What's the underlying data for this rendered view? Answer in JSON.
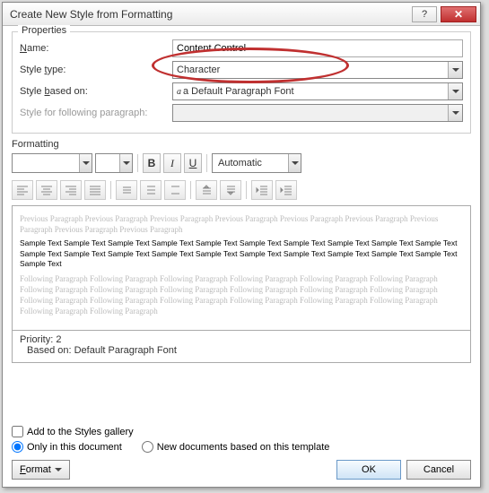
{
  "title": "Create New Style from Formatting",
  "sections": {
    "properties": "Properties",
    "formatting": "Formatting"
  },
  "labels": {
    "name": "Name:",
    "style_type": "Style type:",
    "style_based_on": "Style based on:",
    "following_para": "Style for following paragraph:"
  },
  "values": {
    "name": "Content Control",
    "style_type": "Character",
    "style_based_on": "a Default Paragraph Font",
    "automatic": "Automatic"
  },
  "buttons": {
    "bold": "B",
    "italic": "I",
    "underline": "U",
    "format": "Format",
    "ok": "OK",
    "cancel": "Cancel"
  },
  "preview": {
    "ghost_prev": "Previous Paragraph Previous Paragraph Previous Paragraph Previous Paragraph Previous Paragraph Previous Paragraph Previous Paragraph Previous Paragraph Previous Paragraph",
    "sample": "Sample Text Sample Text Sample Text Sample Text Sample Text Sample Text Sample Text Sample Text Sample Text Sample Text Sample Text Sample Text Sample Text Sample Text Sample Text Sample Text Sample Text Sample Text Sample Text Sample Text Sample Text",
    "ghost_next": "Following Paragraph Following Paragraph Following Paragraph Following Paragraph Following Paragraph Following Paragraph Following Paragraph Following Paragraph Following Paragraph Following Paragraph Following Paragraph Following Paragraph Following Paragraph Following Paragraph Following Paragraph Following Paragraph Following Paragraph Following Paragraph Following Paragraph Following Paragraph"
  },
  "info": {
    "priority_line": "Priority: 2",
    "based_on_line": "Based on: Default Paragraph Font"
  },
  "checks": {
    "add_gallery": "Add to the Styles gallery",
    "only_doc": "Only in this document",
    "new_docs": "New documents based on this template"
  }
}
